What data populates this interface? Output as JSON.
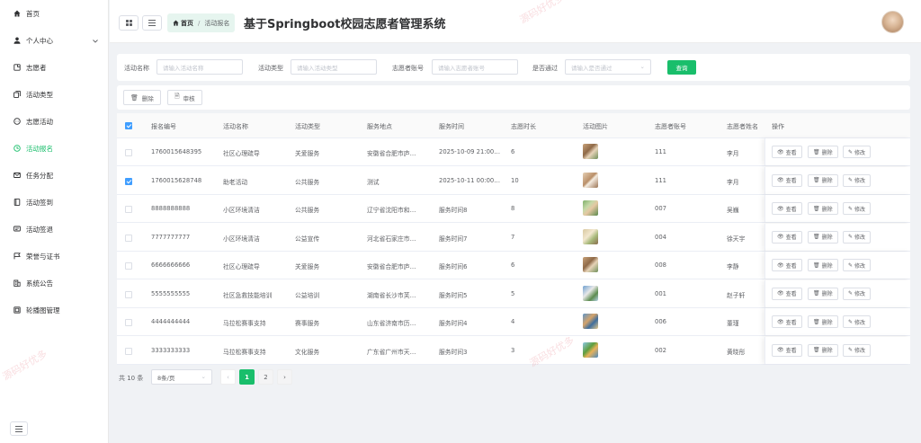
{
  "app": {
    "title": "基于Springboot校园志愿者管理系统"
  },
  "sidebar": {
    "items": [
      {
        "label": "首页",
        "icon": "home-icon"
      },
      {
        "label": "个人中心",
        "icon": "user-icon"
      },
      {
        "label": "志愿者",
        "icon": "note-icon"
      },
      {
        "label": "活动类型",
        "icon": "copy-icon"
      },
      {
        "label": "志愿活动",
        "icon": "chat-icon"
      },
      {
        "label": "活动报名",
        "icon": "clock-icon"
      },
      {
        "label": "任务分配",
        "icon": "mail-icon"
      },
      {
        "label": "活动签到",
        "icon": "book-icon"
      },
      {
        "label": "活动签退",
        "icon": "message-icon"
      },
      {
        "label": "荣誉与证书",
        "icon": "flag-icon"
      },
      {
        "label": "系统公告",
        "icon": "building-icon"
      },
      {
        "label": "轮播图管理",
        "icon": "image-icon"
      }
    ],
    "active": "活动报名"
  },
  "header": {
    "breadcrumb": {
      "home": "首页",
      "sep": "/",
      "current": "活动报名"
    }
  },
  "search": {
    "activity_name_label": "活动名称",
    "activity_name_placeholder": "请输入活动名称",
    "activity_type_label": "活动类型",
    "activity_type_placeholder": "请输入活动类型",
    "volunteer_account_label": "志愿者账号",
    "volunteer_account_placeholder": "请输入志愿者账号",
    "approved_label": "是否通过",
    "approved_placeholder": "请输入是否通过",
    "query_label": "查询"
  },
  "actions": {
    "delete_label": "删除",
    "review_label": "审核"
  },
  "table": {
    "headers": [
      "报名编号",
      "活动名称",
      "活动类型",
      "服务地点",
      "服务时间",
      "志愿时长",
      "活动图片",
      "志愿者账号",
      "志愿者姓名",
      "操作"
    ],
    "row_actions": {
      "view": "查看",
      "delete": "删除",
      "edit": "修改"
    },
    "rows": [
      {
        "id": "1760015648395",
        "name": "社区心理疏导",
        "type": "关爱服务",
        "place": "安徽省合肥市庐…",
        "time": "2025-10-09 21:00…",
        "hours": "6",
        "thumb": "t1",
        "account": "111",
        "person": "李月",
        "checked": false
      },
      {
        "id": "1760015628748",
        "name": "助老活动",
        "type": "公共服务",
        "place": "测试",
        "time": "2025-10-11 00:00…",
        "hours": "10",
        "thumb": "t2",
        "account": "111",
        "person": "李月",
        "checked": true
      },
      {
        "id": "8888888888",
        "name": "小区环境清洁",
        "type": "公共服务",
        "place": "辽宁省沈阳市和…",
        "time": "服务时间8",
        "hours": "8",
        "thumb": "t3",
        "account": "007",
        "person": "吴巍",
        "checked": false
      },
      {
        "id": "7777777777",
        "name": "小区环境清洁",
        "type": "公益宣传",
        "place": "河北省石家庄市…",
        "time": "服务时间7",
        "hours": "7",
        "thumb": "t4",
        "account": "004",
        "person": "徐天宇",
        "checked": false
      },
      {
        "id": "6666666666",
        "name": "社区心理疏导",
        "type": "关爱服务",
        "place": "安徽省合肥市庐…",
        "time": "服务时间6",
        "hours": "6",
        "thumb": "t1",
        "account": "008",
        "person": "李静",
        "checked": false
      },
      {
        "id": "5555555555",
        "name": "社区急救技能培训",
        "type": "公益培训",
        "place": "湖南省长沙市芙…",
        "time": "服务时间5",
        "hours": "5",
        "thumb": "t5",
        "account": "001",
        "person": "赵子轩",
        "checked": false
      },
      {
        "id": "4444444444",
        "name": "马拉松赛事支持",
        "type": "赛事服务",
        "place": "山东省济南市历…",
        "time": "服务时间4",
        "hours": "4",
        "thumb": "t6",
        "account": "006",
        "person": "董瑾",
        "checked": false
      },
      {
        "id": "3333333333",
        "name": "马拉松赛事支持",
        "type": "文化服务",
        "place": "广东省广州市天…",
        "time": "服务时间3",
        "hours": "3",
        "thumb": "t7",
        "account": "002",
        "person": "黄晓彤",
        "checked": false
      }
    ]
  },
  "pager": {
    "total": "共 10 条",
    "page_size": "8条/页",
    "prev": "‹",
    "next": "›",
    "pages": [
      "1",
      "2"
    ],
    "current": "1"
  },
  "watermark": "源码好优多",
  "colors": {
    "accent": "#19be6b",
    "checkbox": "#409eff"
  }
}
